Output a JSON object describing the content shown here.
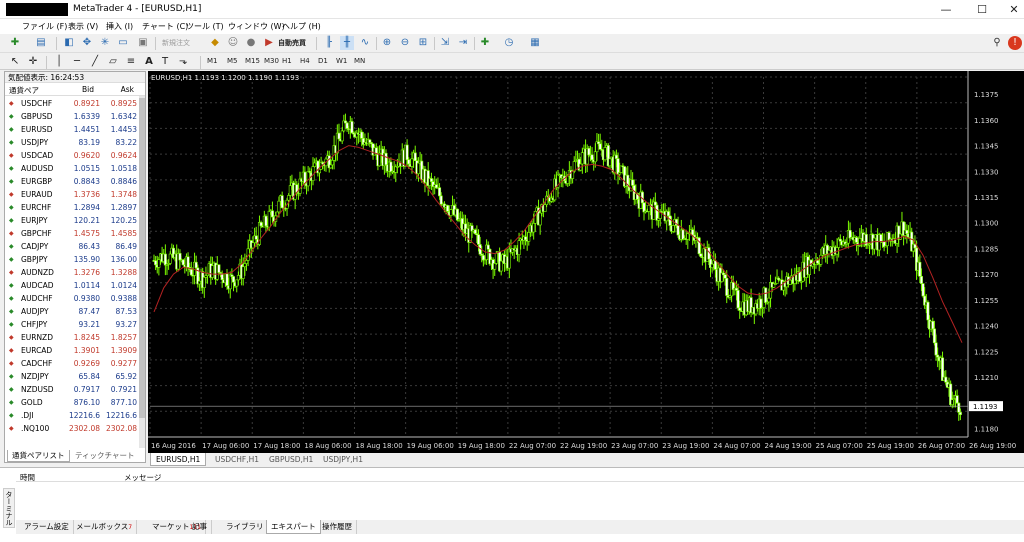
{
  "window": {
    "title": "MetaTrader 4 - [EURUSD,H1]",
    "min": "—",
    "max": "☐",
    "close": "✕"
  },
  "menu": [
    "ファイル (F)",
    "表示 (V)",
    "挿入 (I)",
    "チャート (C)",
    "ツール (T)",
    "ウィンドウ (W)",
    "ヘルプ (H)"
  ],
  "toolbar": {
    "new_order": "新規注文",
    "autotrade": "自動売買",
    "timeframes": [
      "M1",
      "M5",
      "M15",
      "M30",
      "H1",
      "H4",
      "D1",
      "W1",
      "MN"
    ]
  },
  "market_watch": {
    "title": "気配値表示: 16:24:53",
    "col_symbol": "通貨ペア",
    "col_bid": "Bid",
    "col_ask": "Ask",
    "rows": [
      {
        "sym": "USDCHF",
        "bid": "0.8921",
        "ask": "0.8925",
        "dir": "dn"
      },
      {
        "sym": "GBPUSD",
        "bid": "1.6339",
        "ask": "1.6342",
        "dir": "up"
      },
      {
        "sym": "EURUSD",
        "bid": "1.4451",
        "ask": "1.4453",
        "dir": "up"
      },
      {
        "sym": "USDJPY",
        "bid": "83.19",
        "ask": "83.22",
        "dir": "up"
      },
      {
        "sym": "USDCAD",
        "bid": "0.9620",
        "ask": "0.9624",
        "dir": "dn"
      },
      {
        "sym": "AUDUSD",
        "bid": "1.0515",
        "ask": "1.0518",
        "dir": "up"
      },
      {
        "sym": "EURGBP",
        "bid": "0.8843",
        "ask": "0.8846",
        "dir": "up"
      },
      {
        "sym": "EURAUD",
        "bid": "1.3736",
        "ask": "1.3748",
        "dir": "dn"
      },
      {
        "sym": "EURCHF",
        "bid": "1.2894",
        "ask": "1.2897",
        "dir": "up"
      },
      {
        "sym": "EURJPY",
        "bid": "120.21",
        "ask": "120.25",
        "dir": "up"
      },
      {
        "sym": "GBPCHF",
        "bid": "1.4575",
        "ask": "1.4585",
        "dir": "dn"
      },
      {
        "sym": "CADJPY",
        "bid": "86.43",
        "ask": "86.49",
        "dir": "up"
      },
      {
        "sym": "GBPJPY",
        "bid": "135.90",
        "ask": "136.00",
        "dir": "up"
      },
      {
        "sym": "AUDNZD",
        "bid": "1.3276",
        "ask": "1.3288",
        "dir": "dn"
      },
      {
        "sym": "AUDCAD",
        "bid": "1.0114",
        "ask": "1.0124",
        "dir": "up"
      },
      {
        "sym": "AUDCHF",
        "bid": "0.9380",
        "ask": "0.9388",
        "dir": "up"
      },
      {
        "sym": "AUDJPY",
        "bid": "87.47",
        "ask": "87.53",
        "dir": "up"
      },
      {
        "sym": "CHFJPY",
        "bid": "93.21",
        "ask": "93.27",
        "dir": "up"
      },
      {
        "sym": "EURNZD",
        "bid": "1.8245",
        "ask": "1.8257",
        "dir": "dn"
      },
      {
        "sym": "EURCAD",
        "bid": "1.3901",
        "ask": "1.3909",
        "dir": "dn"
      },
      {
        "sym": "CADCHF",
        "bid": "0.9269",
        "ask": "0.9277",
        "dir": "dn"
      },
      {
        "sym": "NZDJPY",
        "bid": "65.84",
        "ask": "65.92",
        "dir": "up"
      },
      {
        "sym": "NZDUSD",
        "bid": "0.7917",
        "ask": "0.7921",
        "dir": "up"
      },
      {
        "sym": "GOLD",
        "bid": "876.10",
        "ask": "877.10",
        "dir": "up"
      },
      {
        "sym": ".DJI",
        "bid": "12216.6",
        "ask": "12216.6",
        "dir": "up"
      },
      {
        "sym": ".NQ100",
        "bid": "2302.08",
        "ask": "2302.08",
        "dir": "dn"
      }
    ],
    "tabs": [
      "通貨ペアリスト",
      "ティックチャート"
    ]
  },
  "chart_tabs": [
    "EURUSD,H1",
    "USDCHF,H1",
    "GBPUSD,H1",
    "USDJPY,H1"
  ],
  "terminal": {
    "side_label": "ターミナル",
    "col_time": "時間",
    "col_message": "メッセージ",
    "tabs": [
      {
        "label": "アラーム設定",
        "badge": ""
      },
      {
        "label": "メールボックス",
        "badge": "7"
      },
      {
        "label": "マーケット",
        "badge": "111"
      },
      {
        "label": "記事",
        "badge": ""
      },
      {
        "label": "ライブラリ",
        "badge": ""
      },
      {
        "label": "エキスパート",
        "badge": ""
      },
      {
        "label": "操作履歴",
        "badge": ""
      }
    ]
  },
  "chart_data": {
    "type": "candlestick",
    "title": "EURUSD,H1  1.1193 1.1200 1.1190 1.1193",
    "y_ticks": [
      "1.1375",
      "1.1360",
      "1.1345",
      "1.1330",
      "1.1315",
      "1.1300",
      "1.1285",
      "1.1270",
      "1.1255",
      "1.1240",
      "1.1225",
      "1.1210",
      "1.1180"
    ],
    "current_price": "1.1193",
    "x_ticks": [
      "16 Aug 2016",
      "17 Aug 06:00",
      "17 Aug 18:00",
      "18 Aug 06:00",
      "18 Aug 18:00",
      "19 Aug 06:00",
      "19 Aug 18:00",
      "22 Aug 07:00",
      "22 Aug 19:00",
      "23 Aug 07:00",
      "23 Aug 19:00",
      "24 Aug 07:00",
      "24 Aug 19:00",
      "25 Aug 07:00",
      "25 Aug 19:00",
      "26 Aug 07:00",
      "26 Aug 19:00"
    ],
    "ylim": [
      1.1175,
      1.1385
    ],
    "close_path": [
      1.1278,
      1.1281,
      1.1279,
      1.1276,
      1.1272,
      1.1268,
      1.1273,
      1.127,
      1.1266,
      1.1272,
      1.1286,
      1.1296,
      1.1303,
      1.1311,
      1.1317,
      1.1322,
      1.1328,
      1.1333,
      1.1338,
      1.1348,
      1.136,
      1.1352,
      1.1345,
      1.1339,
      1.1334,
      1.1336,
      1.134,
      1.1333,
      1.1325,
      1.1318,
      1.1312,
      1.1303,
      1.1295,
      1.129,
      1.1283,
      1.1278,
      1.1276,
      1.1283,
      1.1291,
      1.13,
      1.1309,
      1.1319,
      1.1325,
      1.1333,
      1.1338,
      1.1341,
      1.1343,
      1.1336,
      1.1329,
      1.132,
      1.1313,
      1.1307,
      1.1305,
      1.13,
      1.1296,
      1.1293,
      1.1287,
      1.1279,
      1.127,
      1.1262,
      1.1254,
      1.1251,
      1.1253,
      1.1258,
      1.1262,
      1.1266,
      1.1268,
      1.1275,
      1.1279,
      1.1283,
      1.1286,
      1.1289,
      1.1291,
      1.1292,
      1.129,
      1.1286,
      1.1293,
      1.1298,
      1.1285,
      1.126,
      1.1235,
      1.1212,
      1.1197,
      1.1193
    ],
    "ma_path": [
      1.1248,
      1.1262,
      1.127,
      1.1274,
      1.1273,
      1.1271,
      1.127,
      1.127,
      1.1271,
      1.1276,
      1.1283,
      1.1291,
      1.1298,
      1.1306,
      1.1313,
      1.132,
      1.1326,
      1.1332,
      1.1337,
      1.1342,
      1.1345,
      1.1344,
      1.1342,
      1.134,
      1.1338,
      1.1336,
      1.1333,
      1.1328,
      1.1321,
      1.1313,
      1.1306,
      1.1299,
      1.1292,
      1.1287,
      1.1283,
      1.1282,
      1.1284,
      1.1289,
      1.1295,
      1.1303,
      1.1311,
      1.1319,
      1.1325,
      1.133,
      1.1333,
      1.1334,
      1.1333,
      1.1331,
      1.1326,
      1.132,
      1.1315,
      1.131,
      1.1306,
      1.1302,
      1.1298,
      1.1294,
      1.1289,
      1.1283,
      1.1276,
      1.1269,
      1.1263,
      1.1259,
      1.1258,
      1.1259,
      1.1262,
      1.1266,
      1.127,
      1.1274,
      1.1278,
      1.1281,
      1.1283,
      1.1285,
      1.1287,
      1.1288,
      1.1289,
      1.1289,
      1.129,
      1.1292,
      1.129,
      1.1281,
      1.1268,
      1.1254,
      1.1242,
      1.123
    ],
    "grid": true
  }
}
